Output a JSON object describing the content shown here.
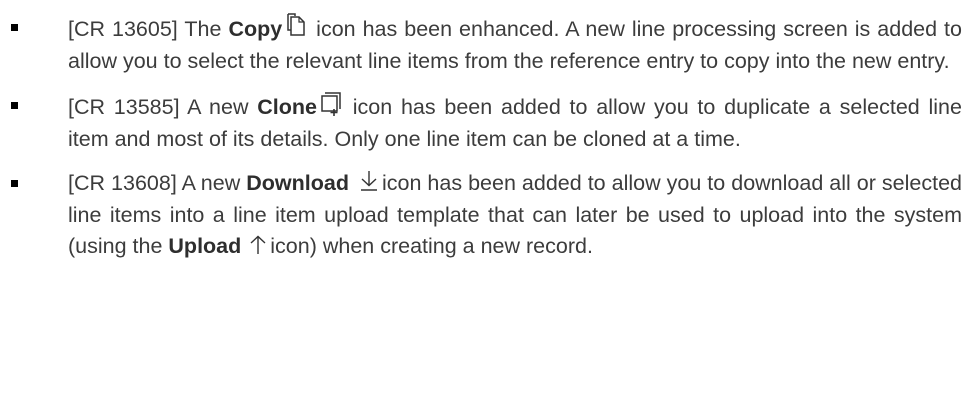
{
  "items": [
    {
      "ref": "[CR 13605]",
      "pre": "The",
      "bold": "Copy",
      "icon": "copy-icon",
      "post": "icon has been enhanced. A new line processing screen is added to allow you to select the relevant line items from the reference entry to copy into the new entry."
    },
    {
      "ref": "[CR 13585]",
      "pre": "A new",
      "bold": "Clone",
      "icon": "clone-icon",
      "post": "icon has been added to allow you to duplicate a selected line item and most of its details. Only one line item can be cloned at a time."
    },
    {
      "ref": "[CR 13608]",
      "pre": "A new",
      "bold": "Download",
      "icon": "download-icon",
      "post": "icon has been added to allow you to download all or selected line items into a line item upload template that can later be used to upload into the system (using the",
      "bold2": "Upload",
      "icon2": "upload-icon",
      "post2": "icon) when creating a new record."
    }
  ]
}
